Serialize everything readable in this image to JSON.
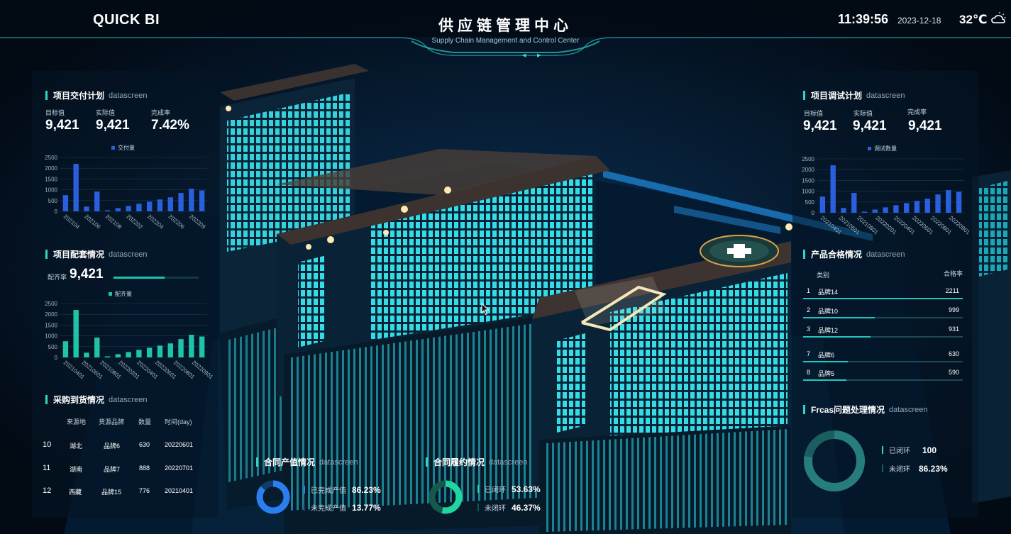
{
  "header": {
    "brand": "QUICK BI",
    "title": "供应链管理中心",
    "subtitle": "Supply Chain Management and Control Center",
    "time": "11:39:56",
    "date": "2023-12-18",
    "temperature": "32℃",
    "weather_icon": "cloud-sun-icon"
  },
  "delivery_plan": {
    "title": "项目交付计划",
    "tag": "datascreen",
    "kpis": [
      {
        "label": "目标值",
        "value": "9,421"
      },
      {
        "label": "实际值",
        "value": "9,421"
      },
      {
        "label": "完成率",
        "value": "7.42%"
      }
    ],
    "legend": "交付量",
    "color": "#2a5fe0"
  },
  "matching": {
    "title": "项目配套情况",
    "tag": "datascreen",
    "rate_label": "配齐率",
    "rate_value": "9,421",
    "rate_fraction": 0.6,
    "legend": "配齐量",
    "color": "#1fc4a8"
  },
  "procurement": {
    "title": "采购到货情况",
    "tag": "datascreen",
    "columns": [
      "来源地",
      "货源品牌",
      "数量",
      "时间(day)"
    ],
    "rows": [
      {
        "idx": "10",
        "origin": "湖北",
        "brand": "品牌6",
        "qty": "630",
        "time": "20220601"
      },
      {
        "idx": "11",
        "origin": "湖南",
        "brand": "品牌7",
        "qty": "888",
        "time": "20220701"
      },
      {
        "idx": "12",
        "origin": "西藏",
        "brand": "品牌15",
        "qty": "776",
        "time": "20210401"
      }
    ]
  },
  "debug_plan": {
    "title": "项目调试计划",
    "tag": "datascreen",
    "kpis": [
      {
        "label": "目标值",
        "value": "9,421"
      },
      {
        "label": "实际值",
        "value": "9,421"
      },
      {
        "label": "完成率",
        "value": "9,421"
      }
    ],
    "legend": "调试数量",
    "color": "#2a5fe0"
  },
  "quality": {
    "title": "产品合格情况",
    "tag": "datascreen",
    "col_category": "类别",
    "col_rate": "合格率",
    "rows": [
      {
        "rank": "1",
        "name": "品牌14",
        "value": "2211",
        "fraction": 1.0
      },
      {
        "rank": "2",
        "name": "品牌10",
        "value": "999",
        "fraction": 0.45
      },
      {
        "rank": "3",
        "name": "品牌12",
        "value": "931",
        "fraction": 0.42
      },
      {
        "rank": "7",
        "name": "品牌6",
        "value": "630",
        "fraction": 0.28
      },
      {
        "rank": "8",
        "name": "品牌5",
        "value": "590",
        "fraction": 0.27
      }
    ]
  },
  "frcas": {
    "title": "Frcas问题处理情况",
    "tag": "datascreen",
    "items": [
      {
        "label": "已闭环",
        "value": "100",
        "color": "#2fd6c8"
      },
      {
        "label": "未闭环",
        "value": "86.23%",
        "color": "#1b5e60"
      }
    ]
  },
  "contract_value": {
    "title": "合同产值情况",
    "tag": "datascreen",
    "items": [
      {
        "label": "已完成产值",
        "value": "86.23%",
        "color": "#2a7ef0"
      },
      {
        "label": "未完成产值",
        "value": "13.77%",
        "color": "#133a6a"
      }
    ],
    "done_fraction": 0.8623
  },
  "contract_perf": {
    "title": "合同履约情况",
    "tag": "datascreen",
    "items": [
      {
        "label": "已闭环",
        "value": "53.63%",
        "color": "#1fd6a0"
      },
      {
        "label": "未闭环",
        "value": "46.37%",
        "color": "#145a4c"
      }
    ],
    "done_fraction": 0.5363
  },
  "chart_data": [
    {
      "type": "bar",
      "title": "",
      "series": [
        {
          "name": "交付量",
          "values": [
            750,
            2200,
            220,
            920,
            50,
            150,
            250,
            350,
            450,
            550,
            650,
            850,
            1050,
            970
          ]
        }
      ],
      "x_tick_labels": [
        "202104",
        "202106",
        "202108",
        "202202",
        "202204",
        "202206",
        "202209"
      ],
      "ylim": [
        0,
        2500
      ],
      "yticks": [
        0,
        500,
        1000,
        1500,
        2000,
        2500
      ],
      "grid": true,
      "legend": "top-center"
    },
    {
      "type": "bar",
      "title": "",
      "series": [
        {
          "name": "配齐量",
          "values": [
            750,
            2200,
            220,
            920,
            50,
            150,
            250,
            350,
            450,
            550,
            650,
            850,
            1050,
            970
          ]
        }
      ],
      "x_tick_labels": [
        "20210401",
        "20210601",
        "20210801",
        "20220201",
        "20220401",
        "20220601",
        "20220801",
        "20220901"
      ],
      "ylim": [
        0,
        2500
      ],
      "yticks": [
        0,
        500,
        1000,
        1500,
        2000,
        2500
      ],
      "grid": true,
      "legend": "top-center"
    },
    {
      "type": "bar",
      "title": "",
      "series": [
        {
          "name": "调试数量",
          "values": [
            750,
            2200,
            220,
            920,
            50,
            150,
            250,
            350,
            450,
            550,
            650,
            850,
            1050,
            970
          ]
        }
      ],
      "x_tick_labels": [
        "20210401",
        "20210601",
        "20210801",
        "20220201",
        "20220401",
        "20220601",
        "20220801",
        "20220901"
      ],
      "ylim": [
        0,
        2500
      ],
      "yticks": [
        0,
        500,
        1000,
        1500,
        2000,
        2500
      ],
      "grid": true,
      "legend": "top-center"
    }
  ]
}
